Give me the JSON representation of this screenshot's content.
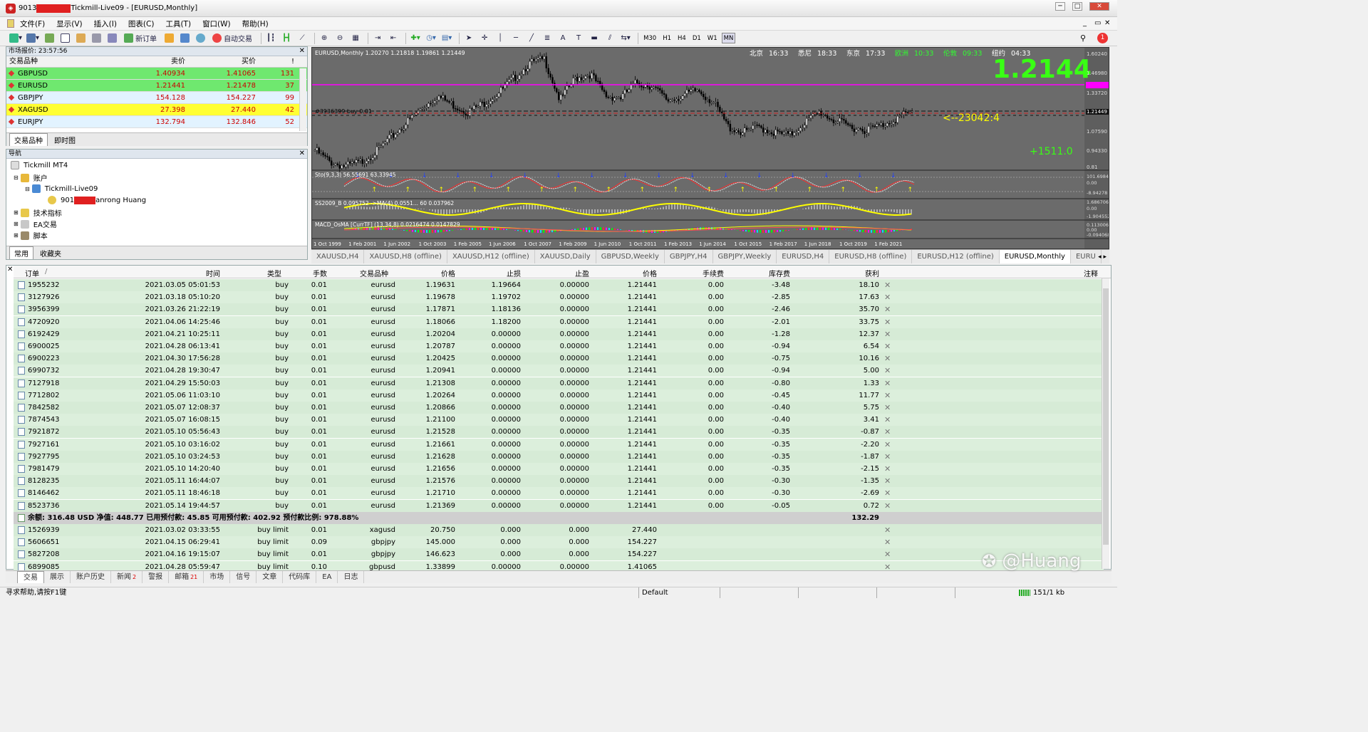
{
  "window": {
    "title_prefix": "9013",
    "title_suffix": "Tickmill-Live09 - [EURUSD,Monthly]",
    "min": "─",
    "max": "□",
    "close": "✕"
  },
  "menu": [
    "文件(F)",
    "显示(V)",
    "插入(I)",
    "图表(C)",
    "工具(T)",
    "窗口(W)",
    "帮助(H)"
  ],
  "toolbar": {
    "new_order": "新订单",
    "auto_trade": "自动交易",
    "timeframes": [
      "M30",
      "H1",
      "H4",
      "D1",
      "W1",
      "MN"
    ],
    "active_tf": "MN",
    "alert_count": "1"
  },
  "market_watch": {
    "header": "市场报价: 23:57:56",
    "col_symbol": "交易品种",
    "col_bid": "卖价",
    "col_ask": "买价",
    "col_spread": "!",
    "rows": [
      {
        "symbol": "GBPUSD",
        "bid": "1.40934",
        "ask": "1.41065",
        "spread": "131",
        "bg": "#6fe86f"
      },
      {
        "symbol": "EURUSD",
        "bid": "1.21441",
        "ask": "1.21478",
        "spread": "37",
        "bg": "#6fe86f"
      },
      {
        "symbol": "GBPJPY",
        "bid": "154.128",
        "ask": "154.227",
        "spread": "99",
        "bg": "#e2f3ff"
      },
      {
        "symbol": "XAGUSD",
        "bid": "27.398",
        "ask": "27.440",
        "spread": "42",
        "bg": "#ffff33"
      },
      {
        "symbol": "EURJPY",
        "bid": "132.794",
        "ask": "132.846",
        "spread": "52",
        "bg": "#e2f3ff"
      }
    ],
    "tabs": [
      "交易品种",
      "即时图"
    ]
  },
  "navigator": {
    "header": "导航",
    "broker": "Tickmill MT4",
    "accounts": "账户",
    "server": "Tickmill-Live09",
    "account_prefix": "901",
    "account_suffix": "anrong Huang",
    "indicators": "技术指标",
    "ea": "EA交易",
    "scripts": "脚本",
    "tabs": [
      "常用",
      "收藏夹"
    ]
  },
  "chart": {
    "symbol_info": "EURUSD,Monthly  1.20270 1.21818 1.19861 1.21449",
    "big_price": "1.2144",
    "arrow_label": "<--23042:4",
    "profit_label": "+1511.0",
    "order_label": "#3936399 buy 0.01",
    "clocks": [
      {
        "city": "北京",
        "time": "16:33",
        "color": "#ffffff"
      },
      {
        "city": "悉尼",
        "time": "18:33",
        "color": "#ffffff"
      },
      {
        "city": "东京",
        "time": "17:33",
        "color": "#ffffff"
      },
      {
        "city": "欧洲",
        "time": "10:33",
        "color": "#30ff30"
      },
      {
        "city": "伦敦",
        "time": "09:33",
        "color": "#30ff30"
      },
      {
        "city": "纽约",
        "time": "04:33",
        "color": "#ffffff"
      }
    ],
    "price_axis": [
      "1.60240",
      "1.46980",
      "1.33720",
      "1.21449",
      "1.07590",
      "0.94330",
      "0.81"
    ],
    "sto_axis": [
      "101.69841",
      "0.00",
      "-8.94278"
    ],
    "ss_axis": [
      "1.686706",
      "0.00",
      "-1.904552"
    ],
    "macd_axis": [
      "0.1130064",
      "0.00",
      "-0.094068"
    ],
    "dates": [
      "1 Oct 1999",
      "1 Feb 2001",
      "1 Jun 2002",
      "1 Oct 2003",
      "1 Feb 2005",
      "1 Jun 2006",
      "1 Oct 2007",
      "1 Feb 2009",
      "1 Jun 2010",
      "1 Oct 2011",
      "1 Feb 2013",
      "1 Jun 2014",
      "1 Oct 2015",
      "1 Feb 2017",
      "1 Jun 2018",
      "1 Oct 2019",
      "1 Feb 2021"
    ],
    "sto_label": "Sto(9,3,3) 56.55691 63.33945",
    "ss_label": "SS2009_B 0.095752 ->MA(4) 0.0551... 60 0.037962",
    "macd_label": "MACD_OsMA [CurrTF] (13,34,8) 0.0216474 0.0147829"
  },
  "chart_tabs": [
    "XAUUSD,H4",
    "XAUUSD,H8 (offline)",
    "XAUUSD,H12 (offline)",
    "XAUUSD,Daily",
    "GBPUSD,Weekly",
    "GBPJPY,H4",
    "GBPJPY,Weekly",
    "EURUSD,H4",
    "EURUSD,H8 (offline)",
    "EURUSD,H12 (offline)",
    "EURUSD,Monthly",
    "EURU"
  ],
  "terminal": {
    "headers": {
      "order": "订单",
      "sort": "/",
      "time": "时间",
      "type": "类型",
      "lots": "手数",
      "symbol": "交易品种",
      "price": "价格",
      "sl": "止损",
      "tp": "止盈",
      "cur": "价格",
      "comm": "手续费",
      "swap": "库存费",
      "profit": "获利",
      "comment": "注释"
    },
    "orders": [
      {
        "order": "1955232",
        "time": "2021.03.05 05:01:53",
        "type": "buy",
        "lots": "0.01",
        "symbol": "eurusd",
        "price": "1.19631",
        "sl": "1.19664",
        "tp": "0.00000",
        "cur": "1.21441",
        "comm": "0.00",
        "swap": "-3.48",
        "profit": "18.10"
      },
      {
        "order": "3127926",
        "time": "2021.03.18 05:10:20",
        "type": "buy",
        "lots": "0.01",
        "symbol": "eurusd",
        "price": "1.19678",
        "sl": "1.19702",
        "tp": "0.00000",
        "cur": "1.21441",
        "comm": "0.00",
        "swap": "-2.85",
        "profit": "17.63"
      },
      {
        "order": "3956399",
        "time": "2021.03.26 21:22:19",
        "type": "buy",
        "lots": "0.01",
        "symbol": "eurusd",
        "price": "1.17871",
        "sl": "1.18136",
        "tp": "0.00000",
        "cur": "1.21441",
        "comm": "0.00",
        "swap": "-2.46",
        "profit": "35.70"
      },
      {
        "order": "4720920",
        "time": "2021.04.06 14:25:46",
        "type": "buy",
        "lots": "0.01",
        "symbol": "eurusd",
        "price": "1.18066",
        "sl": "1.18200",
        "tp": "0.00000",
        "cur": "1.21441",
        "comm": "0.00",
        "swap": "-2.01",
        "profit": "33.75"
      },
      {
        "order": "6192429",
        "time": "2021.04.21 10:25:11",
        "type": "buy",
        "lots": "0.01",
        "symbol": "eurusd",
        "price": "1.20204",
        "sl": "0.00000",
        "tp": "0.00000",
        "cur": "1.21441",
        "comm": "0.00",
        "swap": "-1.28",
        "profit": "12.37"
      },
      {
        "order": "6900025",
        "time": "2021.04.28 06:13:41",
        "type": "buy",
        "lots": "0.01",
        "symbol": "eurusd",
        "price": "1.20787",
        "sl": "0.00000",
        "tp": "0.00000",
        "cur": "1.21441",
        "comm": "0.00",
        "swap": "-0.94",
        "profit": "6.54"
      },
      {
        "order": "6900223",
        "time": "2021.04.30 17:56:28",
        "type": "buy",
        "lots": "0.01",
        "symbol": "eurusd",
        "price": "1.20425",
        "sl": "0.00000",
        "tp": "0.00000",
        "cur": "1.21441",
        "comm": "0.00",
        "swap": "-0.75",
        "profit": "10.16"
      },
      {
        "order": "6990732",
        "time": "2021.04.28 19:30:47",
        "type": "buy",
        "lots": "0.01",
        "symbol": "eurusd",
        "price": "1.20941",
        "sl": "0.00000",
        "tp": "0.00000",
        "cur": "1.21441",
        "comm": "0.00",
        "swap": "-0.94",
        "profit": "5.00"
      },
      {
        "order": "7127918",
        "time": "2021.04.29 15:50:03",
        "type": "buy",
        "lots": "0.01",
        "symbol": "eurusd",
        "price": "1.21308",
        "sl": "0.00000",
        "tp": "0.00000",
        "cur": "1.21441",
        "comm": "0.00",
        "swap": "-0.80",
        "profit": "1.33"
      },
      {
        "order": "7712802",
        "time": "2021.05.06 11:03:10",
        "type": "buy",
        "lots": "0.01",
        "symbol": "eurusd",
        "price": "1.20264",
        "sl": "0.00000",
        "tp": "0.00000",
        "cur": "1.21441",
        "comm": "0.00",
        "swap": "-0.45",
        "profit": "11.77"
      },
      {
        "order": "7842582",
        "time": "2021.05.07 12:08:37",
        "type": "buy",
        "lots": "0.01",
        "symbol": "eurusd",
        "price": "1.20866",
        "sl": "0.00000",
        "tp": "0.00000",
        "cur": "1.21441",
        "comm": "0.00",
        "swap": "-0.40",
        "profit": "5.75"
      },
      {
        "order": "7874543",
        "time": "2021.05.07 16:08:15",
        "type": "buy",
        "lots": "0.01",
        "symbol": "eurusd",
        "price": "1.21100",
        "sl": "0.00000",
        "tp": "0.00000",
        "cur": "1.21441",
        "comm": "0.00",
        "swap": "-0.40",
        "profit": "3.41"
      },
      {
        "order": "7921872",
        "time": "2021.05.10 05:56:43",
        "type": "buy",
        "lots": "0.01",
        "symbol": "eurusd",
        "price": "1.21528",
        "sl": "0.00000",
        "tp": "0.00000",
        "cur": "1.21441",
        "comm": "0.00",
        "swap": "-0.35",
        "profit": "-0.87"
      },
      {
        "order": "7927161",
        "time": "2021.05.10 03:16:02",
        "type": "buy",
        "lots": "0.01",
        "symbol": "eurusd",
        "price": "1.21661",
        "sl": "0.00000",
        "tp": "0.00000",
        "cur": "1.21441",
        "comm": "0.00",
        "swap": "-0.35",
        "profit": "-2.20"
      },
      {
        "order": "7927795",
        "time": "2021.05.10 03:24:53",
        "type": "buy",
        "lots": "0.01",
        "symbol": "eurusd",
        "price": "1.21628",
        "sl": "0.00000",
        "tp": "0.00000",
        "cur": "1.21441",
        "comm": "0.00",
        "swap": "-0.35",
        "profit": "-1.87"
      },
      {
        "order": "7981479",
        "time": "2021.05.10 14:20:40",
        "type": "buy",
        "lots": "0.01",
        "symbol": "eurusd",
        "price": "1.21656",
        "sl": "0.00000",
        "tp": "0.00000",
        "cur": "1.21441",
        "comm": "0.00",
        "swap": "-0.35",
        "profit": "-2.15"
      },
      {
        "order": "8128235",
        "time": "2021.05.11 16:44:07",
        "type": "buy",
        "lots": "0.01",
        "symbol": "eurusd",
        "price": "1.21576",
        "sl": "0.00000",
        "tp": "0.00000",
        "cur": "1.21441",
        "comm": "0.00",
        "swap": "-0.30",
        "profit": "-1.35"
      },
      {
        "order": "8146462",
        "time": "2021.05.11 18:46:18",
        "type": "buy",
        "lots": "0.01",
        "symbol": "eurusd",
        "price": "1.21710",
        "sl": "0.00000",
        "tp": "0.00000",
        "cur": "1.21441",
        "comm": "0.00",
        "swap": "-0.30",
        "profit": "-2.69"
      },
      {
        "order": "8523736",
        "time": "2021.05.14 19:44:57",
        "type": "buy",
        "lots": "0.01",
        "symbol": "eurusd",
        "price": "1.21369",
        "sl": "0.00000",
        "tp": "0.00000",
        "cur": "1.21441",
        "comm": "0.00",
        "swap": "-0.05",
        "profit": "0.72"
      }
    ],
    "summary": {
      "text": "余额: 316.48 USD  净值: 448.77  已用预付款: 45.85  可用预付款: 402.92  预付款比例: 978.88%",
      "profit": "132.29"
    },
    "pending": [
      {
        "order": "1526939",
        "time": "2021.03.02 03:33:55",
        "type": "buy limit",
        "lots": "0.01",
        "symbol": "xagusd",
        "price": "20.750",
        "sl": "0.000",
        "tp": "0.000",
        "cur": "27.440"
      },
      {
        "order": "5606651",
        "time": "2021.04.15 06:29:41",
        "type": "buy limit",
        "lots": "0.09",
        "symbol": "gbpjpy",
        "price": "145.000",
        "sl": "0.000",
        "tp": "0.000",
        "cur": "154.227"
      },
      {
        "order": "5827208",
        "time": "2021.04.16 19:15:07",
        "type": "buy limit",
        "lots": "0.01",
        "symbol": "gbpjpy",
        "price": "146.623",
        "sl": "0.000",
        "tp": "0.000",
        "cur": "154.227"
      },
      {
        "order": "6899085",
        "time": "2021.04.28 05:59:47",
        "type": "buy limit",
        "lots": "0.10",
        "symbol": "gbpusd",
        "price": "1.33899",
        "sl": "0.00000",
        "tp": "0.00000",
        "cur": "1.41065"
      }
    ],
    "tabs": [
      {
        "label": "交易",
        "badge": ""
      },
      {
        "label": "展示",
        "badge": ""
      },
      {
        "label": "账户历史",
        "badge": ""
      },
      {
        "label": "新闻",
        "badge": "2"
      },
      {
        "label": "警报",
        "badge": ""
      },
      {
        "label": "邮箱",
        "badge": "21"
      },
      {
        "label": "市场",
        "badge": ""
      },
      {
        "label": "信号",
        "badge": ""
      },
      {
        "label": "文章",
        "badge": ""
      },
      {
        "label": "代码库",
        "badge": ""
      },
      {
        "label": "EA",
        "badge": ""
      },
      {
        "label": "日志",
        "badge": ""
      }
    ]
  },
  "status": {
    "help": "寻求帮助,请按F1键",
    "profile": "Default",
    "traffic": "151/1 kb"
  },
  "watermark": "@Huang"
}
